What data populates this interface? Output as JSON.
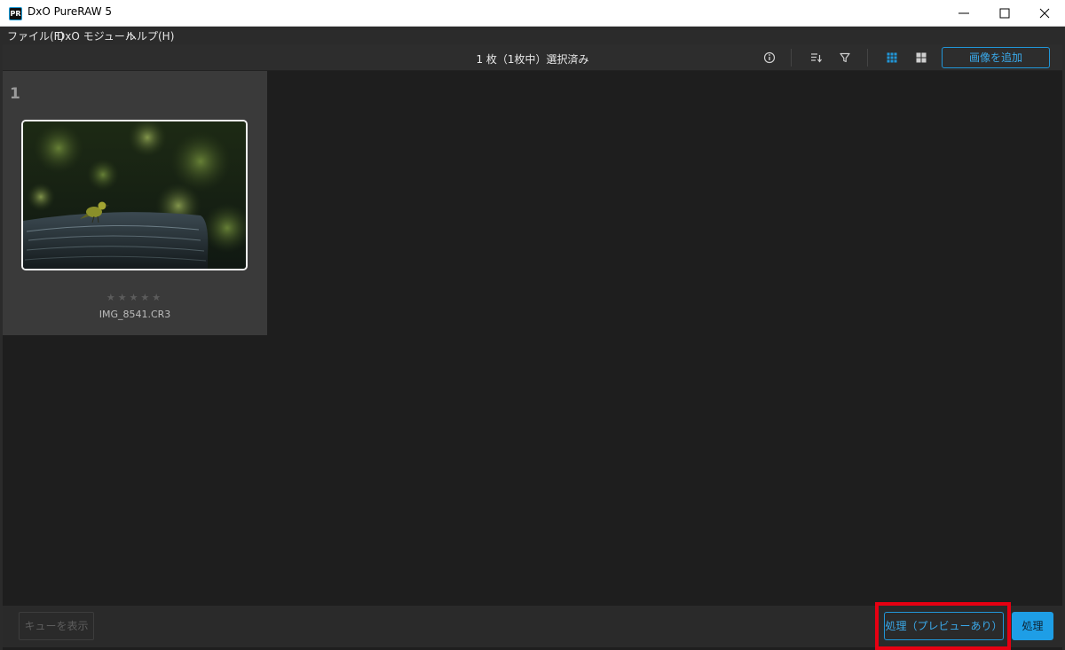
{
  "window": {
    "title": "DxO PureRAW 5",
    "logo_text": "PR",
    "controls": [
      "minimize-icon",
      "maximize-icon",
      "close-icon"
    ]
  },
  "menu": {
    "items": [
      "ファイル(F)",
      "DxO モジュール",
      "ヘルプ(H)"
    ]
  },
  "toolbar": {
    "selection_status": "1 枚（1枚中）選択済み",
    "icons": [
      "info-icon",
      "sort-icon",
      "filter-icon",
      "grid-view-icon",
      "mosaic-view-icon"
    ],
    "add_images_label": "画像を追加",
    "accent_color": "#2196d8"
  },
  "gallery": {
    "items": [
      {
        "index": "1",
        "filename": "IMG_8541.CR3",
        "rating_stars": "★★★★★",
        "rating_value": 0,
        "selected": true
      }
    ]
  },
  "footer": {
    "show_queue_label": "キューを表示",
    "process_preview_label": "処理（プレビューあり）",
    "process_label": "処理",
    "highlight_color": "#e60012"
  }
}
